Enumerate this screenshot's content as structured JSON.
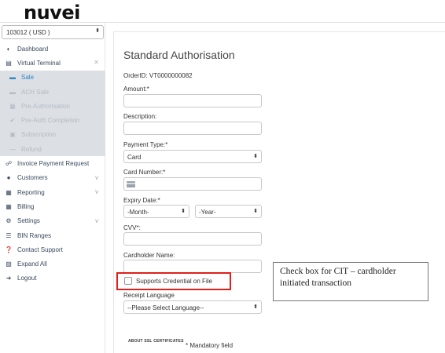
{
  "brand": {
    "logo": "nuvei"
  },
  "sidebar": {
    "account_select": "103012 ( USD )",
    "items": [
      {
        "label": "Dashboard",
        "icon": "dashboard-icon"
      },
      {
        "label": "Virtual Terminal",
        "icon": "terminal-icon",
        "expanded": true
      },
      {
        "label": "Sale",
        "icon": "card-icon",
        "sub": true,
        "active": true
      },
      {
        "label": "ACH Sale",
        "icon": "bank-icon",
        "sub": true
      },
      {
        "label": "Pre-Authorisation",
        "icon": "doc-icon",
        "sub": true
      },
      {
        "label": "Pre-Auth Completion",
        "icon": "check-circle-icon",
        "sub": true
      },
      {
        "label": "Subscription",
        "icon": "calendar-icon",
        "sub": true
      },
      {
        "label": "Refund",
        "icon": "minus-icon",
        "sub": true
      },
      {
        "label": "Invoice Payment Request",
        "icon": "link-icon"
      },
      {
        "label": "Customers",
        "icon": "users-icon"
      },
      {
        "label": "Reporting",
        "icon": "report-icon"
      },
      {
        "label": "Billing",
        "icon": "billing-icon"
      },
      {
        "label": "Settings",
        "icon": "gears-icon"
      },
      {
        "label": "BIN Ranges",
        "icon": "list-icon"
      },
      {
        "label": "Contact Support",
        "icon": "question-icon"
      },
      {
        "label": "Expand All",
        "icon": "expand-icon"
      },
      {
        "label": "Logout",
        "icon": "logout-icon"
      }
    ]
  },
  "form": {
    "title": "Standard Authorisation",
    "order_id": "OrderID: VT0000000082",
    "amount_label": "Amount:*",
    "description_label": "Description:",
    "payment_type_label": "Payment Type:*",
    "payment_type_value": "Card",
    "card_number_label": "Card Number:*",
    "expiry_label": "Expiry Date:*",
    "month_value": "-Month-",
    "year_value": "-Year-",
    "cvv_label": "CVV*:",
    "cardholder_label": "Cardholder Name:",
    "credential_checkbox_label": "Supports Credential on File",
    "receipt_language_label": "Receipt Language",
    "receipt_language_value": "--Please Select Language--",
    "ssl_text": "ABOUT SSL CERTIFICATES",
    "mandatory_note": "* Mandatory field"
  },
  "annotation": {
    "line1": "Check box for CIT – cardholder",
    "line2": "initiated transaction",
    "highlight_color": "#e0201b"
  },
  "colors": {
    "active_nav": "#2f86c9",
    "submenu_bg": "#dcdfe3"
  }
}
